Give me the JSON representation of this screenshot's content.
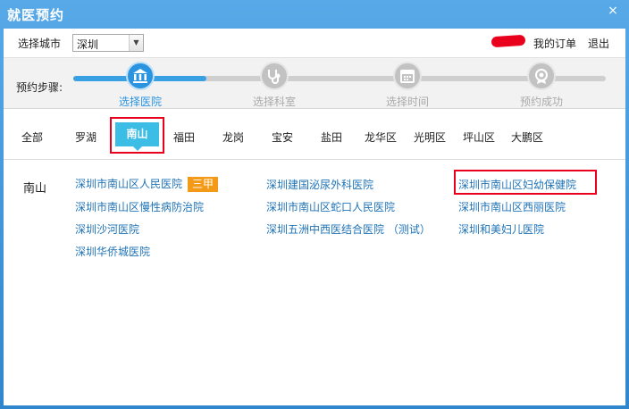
{
  "window": {
    "title": "就医预约",
    "close_glyph": "×"
  },
  "topbar": {
    "city_label": "选择城市",
    "city_value": "深圳",
    "my_orders": "我的订单",
    "logout": "退出"
  },
  "steps": {
    "label": "预约步骤:",
    "progress": 0.25,
    "items": [
      {
        "label": "选择医院",
        "icon": "hospital-icon",
        "active": true
      },
      {
        "label": "选择科室",
        "icon": "stethoscope-icon",
        "active": false
      },
      {
        "label": "选择时间",
        "icon": "calendar-icon",
        "active": false
      },
      {
        "label": "预约成功",
        "icon": "success-icon",
        "active": false
      }
    ]
  },
  "districts": {
    "items": [
      "全部",
      "罗湖",
      "南山",
      "福田",
      "龙岗",
      "宝安",
      "盐田",
      "龙华区",
      "光明区",
      "坪山区",
      "大鹏区"
    ],
    "selected": "南山"
  },
  "hospitals": {
    "area": "南山",
    "badge": "三甲",
    "col1": [
      "深圳市南山区人民医院",
      "深圳市南山区慢性病防治院",
      "深圳沙河医院",
      "深圳华侨城医院"
    ],
    "col2": [
      "深圳建国泌尿外科医院",
      "深圳市南山区蛇口人民医院",
      "深圳五洲中西医结合医院 （测试）"
    ],
    "col3": [
      "深圳市南山区妇幼保健院",
      "深圳市南山区西丽医院",
      "深圳和美妇儿医院"
    ]
  },
  "colors": {
    "accent": "#2b94e0",
    "link": "#1f73b7",
    "highlight_border": "#e8001c",
    "badge": "#f39a18",
    "active_pill": "#3bbde6"
  }
}
